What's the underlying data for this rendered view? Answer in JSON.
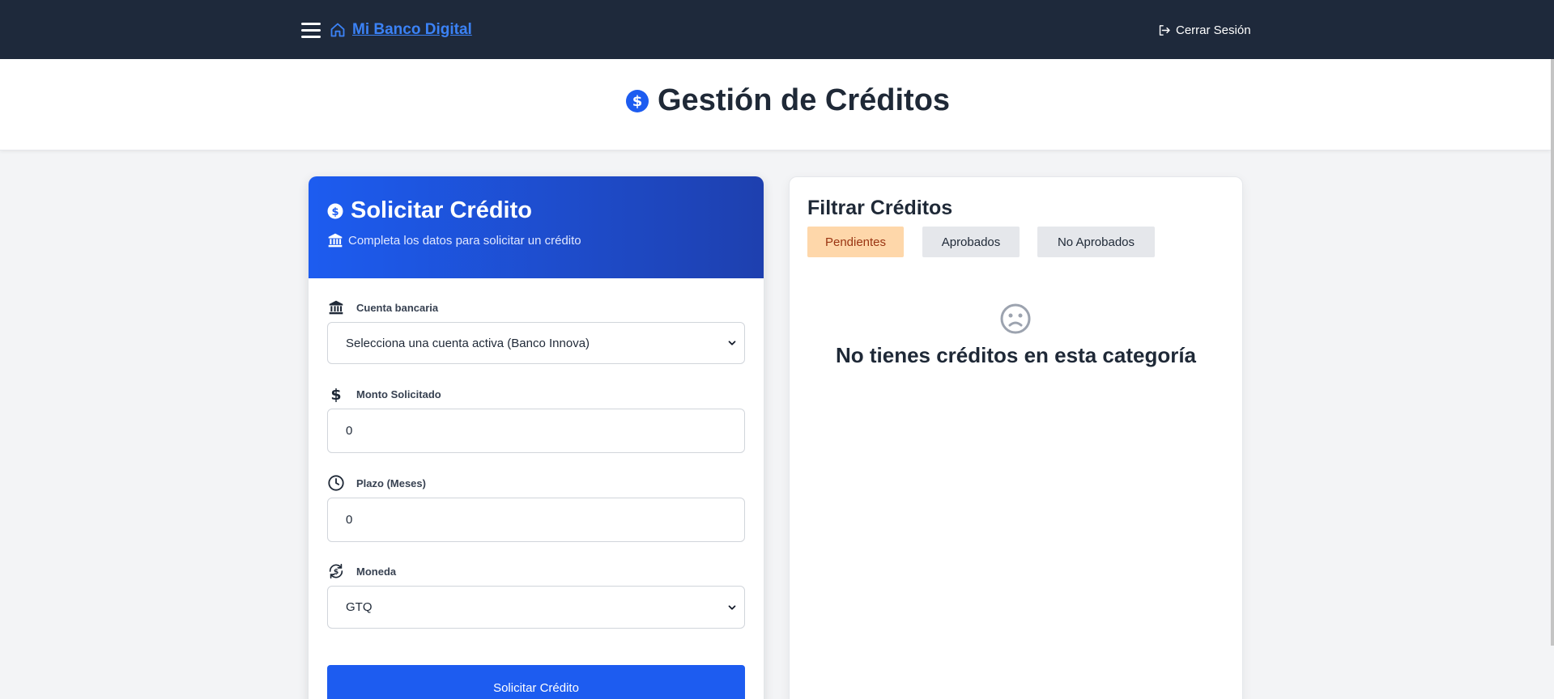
{
  "navbar": {
    "brand": "Mi Banco Digital",
    "logout": "Cerrar Sesión"
  },
  "page": {
    "title": "Gestión de Créditos"
  },
  "request": {
    "title": "Solicitar Crédito",
    "subtitle": "Completa los datos para solicitar un crédito",
    "account_label": "Cuenta bancaria",
    "account_value": "Selecciona una cuenta activa (Banco Innova)",
    "amount_label": "Monto Solicitado",
    "amount_value": "0",
    "term_label": "Plazo (Meses)",
    "term_value": "0",
    "currency_label": "Moneda",
    "currency_value": "GTQ",
    "submit": "Solicitar Crédito"
  },
  "filter": {
    "title": "Filtrar Créditos",
    "tabs": [
      "Pendientes",
      "Aprobados",
      "No Aprobados"
    ],
    "active_tab": "Pendientes",
    "empty_message": "No tienes créditos en esta categoría"
  },
  "colors": {
    "navbar": "#1e293b",
    "primary": "#1d5cf0",
    "active_tab": "#fed7aa"
  },
  "icons": {
    "brand": "home-icon",
    "logout": "logout-icon",
    "title": "dollar-circle-icon",
    "account": "bank-icon",
    "amount": "dollar-icon",
    "term": "clock-icon",
    "currency": "currency-exchange-icon",
    "empty": "sad-face-icon"
  }
}
